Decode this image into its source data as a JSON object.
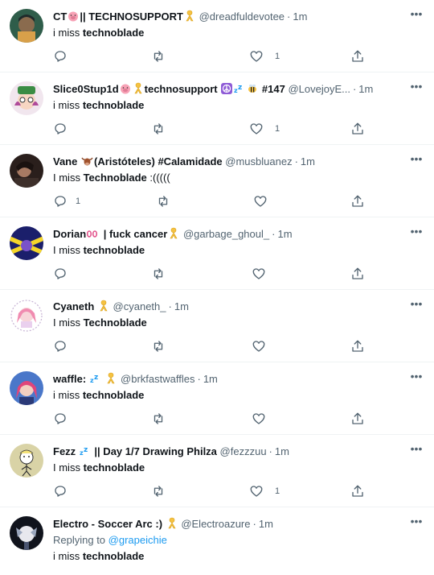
{
  "tweets": [
    {
      "name": "CT",
      "name_after": "|| TECHNOSUPPORT",
      "handle": "@dreadfuldevotee",
      "time": "1m",
      "text_pre": "i miss ",
      "text_bold": "technoblade",
      "text_post": "",
      "reply_count": "",
      "like_count": "1",
      "avatar_bg": "#2f5d4a"
    },
    {
      "name": "Slice0Stup1d",
      "name_after": "technosupport",
      "name_tail": "#147",
      "handle": "@LovejoyE...",
      "time": "1m",
      "text_pre": "i miss ",
      "text_bold": "technoblade",
      "text_post": "",
      "reply_count": "",
      "like_count": "1",
      "avatar_bg": "#e8c7d9"
    },
    {
      "name": "Vane",
      "name_after": "(Aristóteles) #Calamidade",
      "handle": "@musbluanez",
      "time": "1m",
      "text_pre": "I miss ",
      "text_bold": "Technoblade",
      "text_post": " :(((((",
      "reply_count": "1",
      "like_count": "",
      "avatar_bg": "#3a2a24"
    },
    {
      "name": "Dorian",
      "name_after": "| fuck cancer",
      "handle": "@garbage_ghoul_",
      "time": "1m",
      "text_pre": "I miss ",
      "text_bold": "technoblade",
      "text_post": "",
      "reply_count": "",
      "like_count": "",
      "avatar_bg": "#1b1f6b"
    },
    {
      "name": "Cyaneth",
      "name_after": "",
      "handle": "@cyaneth_",
      "time": "1m",
      "text_pre": "I miss ",
      "text_bold": "Technoblade",
      "text_post": "",
      "reply_count": "",
      "like_count": "",
      "avatar_bg": "#f3f0f4"
    },
    {
      "name": "waffle:",
      "name_after": "",
      "handle": "@brkfastwaffles",
      "time": "1m",
      "text_pre": "i miss ",
      "text_bold": "technoblade",
      "text_post": "",
      "reply_count": "",
      "like_count": "",
      "avatar_bg": "#4a77c9"
    },
    {
      "name": "Fezz",
      "name_after": "|| Day 1/7 Drawing Philza",
      "handle": "@fezzzuu",
      "time": "1m",
      "text_pre": "I miss ",
      "text_bold": "technoblade",
      "text_post": "",
      "reply_count": "",
      "like_count": "1",
      "avatar_bg": "#d9d3a6"
    },
    {
      "name": "Electro - Soccer Arc :)",
      "name_after": "",
      "handle": "@Electroazure",
      "time": "1m",
      "reply_label": "Replying to ",
      "reply_mention": "@grapeichie",
      "text_pre": "i miss ",
      "text_bold": "technoblade",
      "text_post": "",
      "reply_count": "",
      "like_count": "",
      "avatar_bg": "#10131c"
    }
  ],
  "icons": {
    "reply": "reply-icon",
    "retweet": "retweet-icon",
    "like": "heart-icon",
    "share": "share-icon",
    "more": "more-icon",
    "ribbon": "yellow-ribbon-icon"
  },
  "colors": {
    "accent": "#1d9bf0",
    "muted": "#536471",
    "text": "#0f1419",
    "ribbon": "#f5c242"
  }
}
